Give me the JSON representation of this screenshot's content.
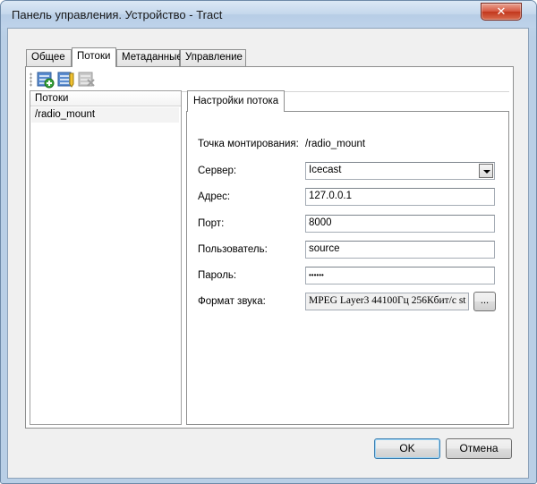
{
  "window": {
    "title": "Панель управления. Устройство - Tract",
    "close_glyph": "✕"
  },
  "tabs": [
    {
      "label": "Общее",
      "active": false
    },
    {
      "label": "Потоки",
      "active": true
    },
    {
      "label": "Метаданные",
      "active": false
    },
    {
      "label": "Управление",
      "active": false
    }
  ],
  "toolbar": {
    "buttons": [
      {
        "icon": "add-stream-icon",
        "enabled": true
      },
      {
        "icon": "edit-stream-icon",
        "enabled": true
      },
      {
        "icon": "delete-stream-icon",
        "enabled": false
      }
    ]
  },
  "streams_list": {
    "header": "Потоки",
    "items": [
      "/radio_mount"
    ]
  },
  "settings": {
    "tab_label": "Настройки потока",
    "mount_label": "Точка монтирования:",
    "mount_value": "/radio_mount",
    "server_label": "Сервер:",
    "server_value": "Icecast",
    "address_label": "Адрес:",
    "address_value": "127.0.0.1",
    "port_label": "Порт:",
    "port_value": "8000",
    "user_label": "Пользователь:",
    "user_value": "source",
    "password_label": "Пароль:",
    "password_value": "••••••",
    "format_label": "Формат звука:",
    "format_value": "MPEG Layer3 44100Гц 256Кбит/с st",
    "browse_label": "..."
  },
  "buttons": {
    "ok": "OK",
    "cancel": "Отмена"
  }
}
